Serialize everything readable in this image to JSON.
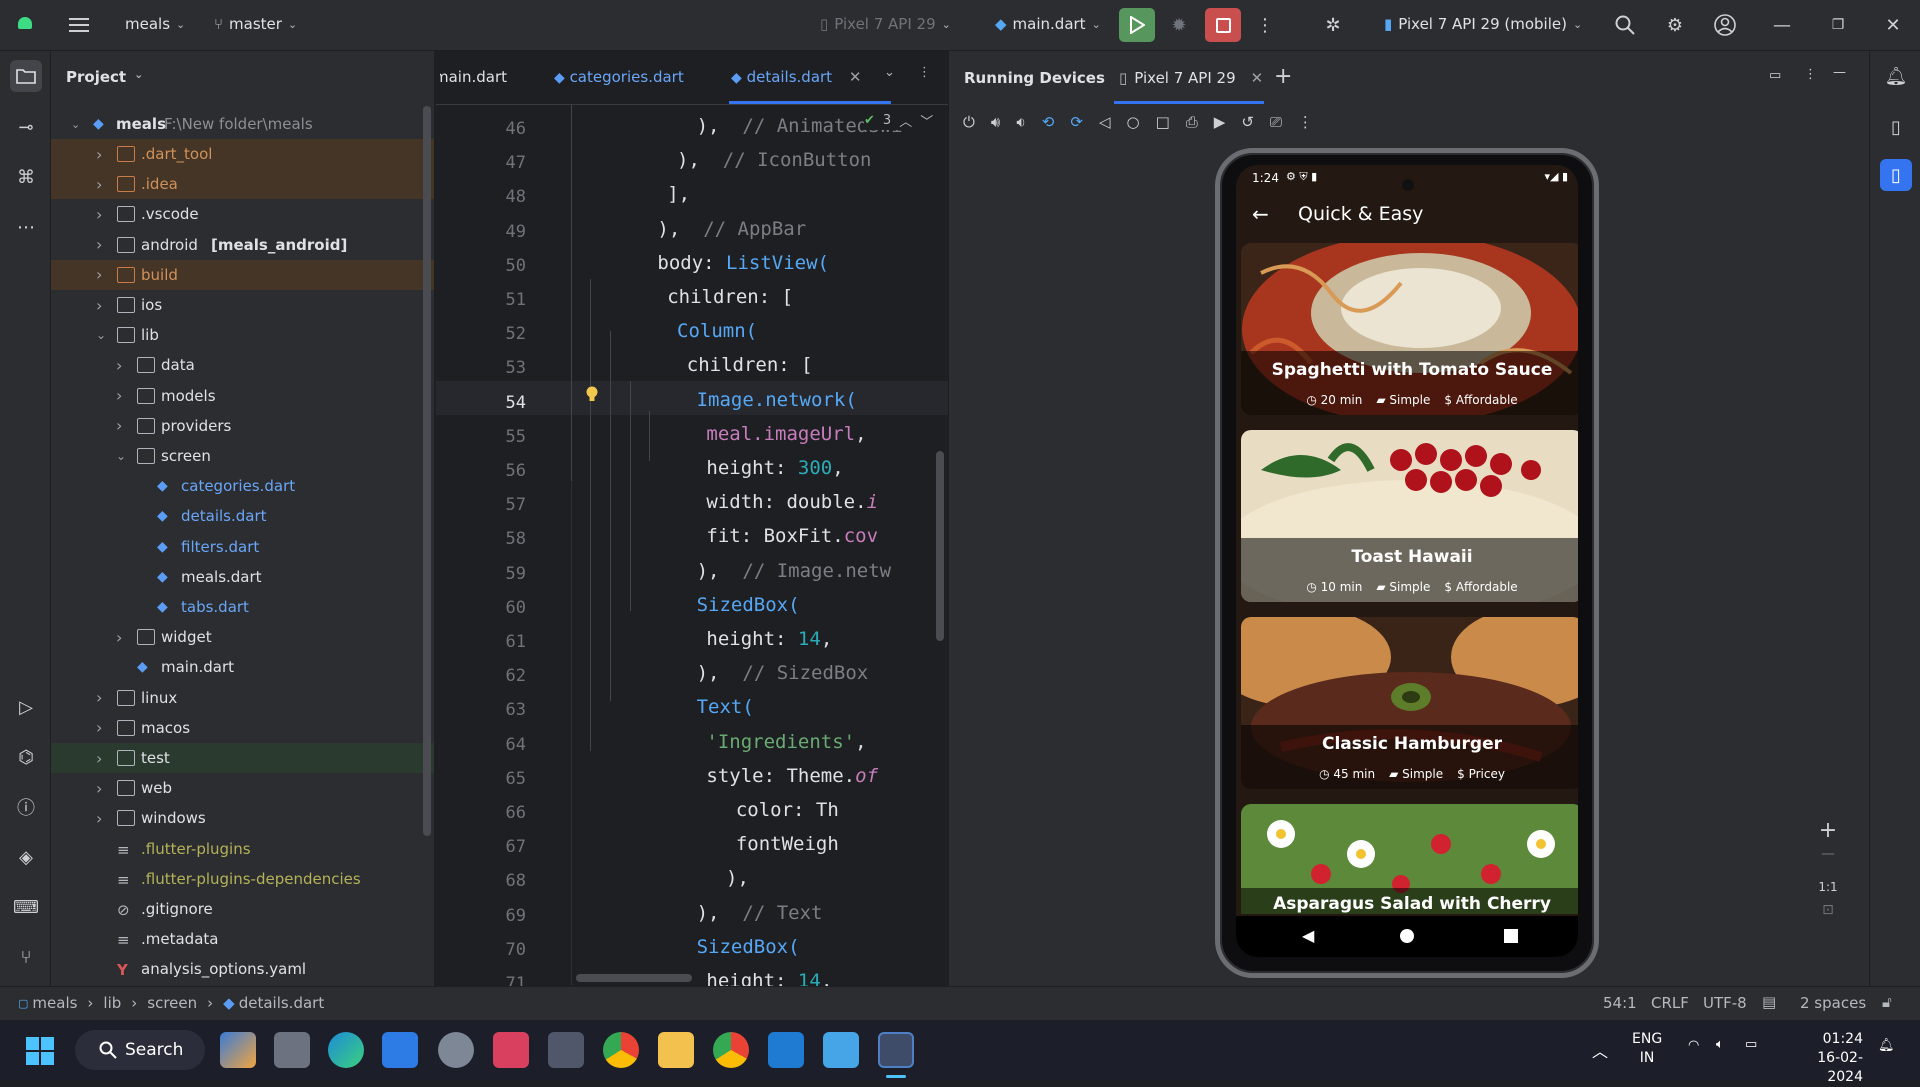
{
  "titlebar": {
    "project": "meals",
    "branch": "master",
    "device_selector": "Pixel 7 API 29",
    "run_config": "main.dart",
    "device_target": "Pixel 7 API 29 (mobile)"
  },
  "project_panel": {
    "title": "Project",
    "root_name": "meals",
    "root_path": "F:\\New folder\\meals",
    "items": [
      {
        "label": ".dart_tool"
      },
      {
        "label": ".idea"
      },
      {
        "label": ".vscode"
      },
      {
        "label": "android",
        "suffix": "[meals_android]"
      },
      {
        "label": "build"
      },
      {
        "label": "ios"
      },
      {
        "label": "lib"
      },
      {
        "label": "data"
      },
      {
        "label": "models"
      },
      {
        "label": "providers"
      },
      {
        "label": "screen"
      },
      {
        "label": "categories.dart"
      },
      {
        "label": "details.dart"
      },
      {
        "label": "filters.dart"
      },
      {
        "label": "meals.dart"
      },
      {
        "label": "tabs.dart"
      },
      {
        "label": "widget"
      },
      {
        "label": "main.dart"
      },
      {
        "label": "linux"
      },
      {
        "label": "macos"
      },
      {
        "label": "test"
      },
      {
        "label": "web"
      },
      {
        "label": "windows"
      },
      {
        "label": ".flutter-plugins"
      },
      {
        "label": ".flutter-plugins-dependencies"
      },
      {
        "label": ".gitignore"
      },
      {
        "label": ".metadata"
      },
      {
        "label": "analysis_options.yaml"
      }
    ]
  },
  "editor": {
    "tabs": [
      {
        "label": "main.dart"
      },
      {
        "label": "categories.dart"
      },
      {
        "label": "details.dart"
      }
    ],
    "inspection_count": "3",
    "line_numbers": [
      "46",
      "47",
      "48",
      "49",
      "50",
      "51",
      "52",
      "53",
      "54",
      "55",
      "56",
      "57",
      "58",
      "59",
      "60",
      "61",
      "62",
      "63",
      "64",
      "65",
      "66",
      "67",
      "68",
      "69",
      "70",
      "71"
    ],
    "code": {
      "l46a": "),",
      "l46b": "// AnimatedSwi",
      "l47a": "),",
      "l47b": "// IconButton",
      "l48": "],",
      "l49a": "),",
      "l49b": "// AppBar",
      "l50a": "body: ",
      "l50b": "ListView(",
      "l51": "children: [",
      "l52": "Column(",
      "l53": "children: [",
      "l54": "Image.network(",
      "l55a": "meal.imageUrl",
      "l55b": ",",
      "l56a": "height: ",
      "l56b": "300",
      "l56c": ",",
      "l57a": "width: double.",
      "l57b": "i",
      "l58a": "fit: BoxFit.",
      "l58b": "cov",
      "l59a": "),",
      "l59b": "// Image.netw",
      "l60": "SizedBox(",
      "l61a": "height: ",
      "l61b": "14",
      "l61c": ",",
      "l62a": "),",
      "l62b": "// SizedBox",
      "l63": "Text(",
      "l64a": "'Ingredients'",
      "l64b": ",",
      "l65a": "style: Theme.",
      "l65b": "of",
      "l66": "color: Th",
      "l67": "fontWeigh",
      "l68": "),",
      "l69a": "),",
      "l69b": "// Text",
      "l70": "SizedBox(",
      "l71a": "height: ",
      "l71b": "14",
      "l71c": ","
    }
  },
  "running_devices": {
    "title": "Running Devices",
    "tab": "Pixel 7 API 29",
    "zoom_label": "1:1"
  },
  "phone": {
    "time": "1:24",
    "appbar_title": "Quick & Easy",
    "meals": [
      {
        "title": "Spaghetti with Tomato Sauce",
        "duration": "20 min",
        "complexity": "Simple",
        "affordability": "Affordable"
      },
      {
        "title": "Toast Hawaii",
        "duration": "10 min",
        "complexity": "Simple",
        "affordability": "Affordable"
      },
      {
        "title": "Classic Hamburger",
        "duration": "45 min",
        "complexity": "Simple",
        "affordability": "Pricey"
      },
      {
        "title": "Asparagus Salad with Cherry"
      }
    ]
  },
  "statusbar": {
    "crumbs": [
      "meals",
      "lib",
      "screen",
      "details.dart"
    ],
    "position": "54:1",
    "line_sep": "CRLF",
    "encoding": "UTF-8",
    "indent": "2 spaces"
  },
  "taskbar": {
    "search": "Search",
    "lang1": "ENG",
    "lang2": "IN",
    "time": "01:24",
    "date": "16-02-2024"
  }
}
